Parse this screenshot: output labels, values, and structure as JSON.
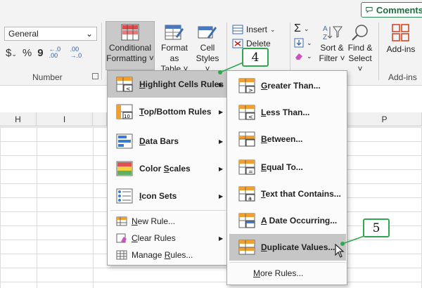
{
  "ribbon": {
    "comments_label": "Comments",
    "number_format": "General",
    "number_group_label": "Number",
    "addins_group_label": "Add-ins",
    "currency_symbol": "$",
    "percent_symbol": "%",
    "comma_symbol": "9",
    "increase_decimal": "←.0 .00",
    "decrease_decimal": ".00 →.0",
    "conditional_formatting": [
      "Conditional",
      "Formatting ˅"
    ],
    "format_as_table": [
      "Format as",
      "Table ˅"
    ],
    "cell_styles": [
      "Cell",
      "Styles ˅"
    ],
    "insert_label": "Insert",
    "delete_label": "Delete",
    "sort_filter": [
      "Sort &",
      "Filter ˅"
    ],
    "find_select": [
      "Find &",
      "Select ˅"
    ],
    "addins_button": "Add-ins"
  },
  "sheet": {
    "columns": [
      "H",
      "I",
      "P"
    ]
  },
  "cf_menu": {
    "items": [
      {
        "prefix": "",
        "key": "H",
        "suffix": "ighlight Cells Rules",
        "icon": "highlight-cells-icon"
      },
      {
        "prefix": "",
        "key": "T",
        "suffix": "op/Bottom Rules",
        "icon": "top-bottom-icon"
      },
      {
        "prefix": "",
        "key": "D",
        "suffix": "ata Bars",
        "icon": "data-bars-icon"
      },
      {
        "prefix": "Color ",
        "key": "S",
        "suffix": "cales",
        "icon": "color-scales-icon"
      },
      {
        "prefix": "",
        "key": "I",
        "suffix": "con Sets",
        "icon": "icon-sets-icon"
      }
    ],
    "small_items": [
      {
        "prefix": "",
        "key": "N",
        "suffix": "ew Rule...",
        "icon": "new-rule-icon"
      },
      {
        "prefix": "",
        "key": "C",
        "suffix": "lear Rules",
        "icon": "clear-rules-icon"
      },
      {
        "prefix": "Manage ",
        "key": "R",
        "suffix": "ules...",
        "icon": "manage-rules-icon"
      }
    ]
  },
  "submenu": {
    "items": [
      {
        "prefix": "",
        "key": "G",
        "suffix": "reater Than...",
        "icon": "greater-than-icon"
      },
      {
        "prefix": "",
        "key": "L",
        "suffix": "ess Than...",
        "icon": "less-than-icon"
      },
      {
        "prefix": "",
        "key": "B",
        "suffix": "etween...",
        "icon": "between-icon"
      },
      {
        "prefix": "",
        "key": "E",
        "suffix": "qual To...",
        "icon": "equal-to-icon"
      },
      {
        "prefix": "",
        "key": "T",
        "suffix": "ext that Contains...",
        "icon": "text-contains-icon"
      },
      {
        "prefix": "",
        "key": "A",
        "suffix": " Date Occurring...",
        "icon": "date-occurring-icon"
      },
      {
        "prefix": "",
        "key": "D",
        "suffix": "uplicate Values...",
        "icon": "duplicate-values-icon"
      }
    ],
    "more_rules": {
      "prefix": "",
      "key": "M",
      "suffix": "ore Rules..."
    }
  },
  "callouts": [
    "4",
    "5"
  ],
  "colors": {
    "accent_green": "#2fa84f",
    "highlight_gray": "#c6c6c6",
    "ribbon_bg": "#f3f3f3"
  }
}
